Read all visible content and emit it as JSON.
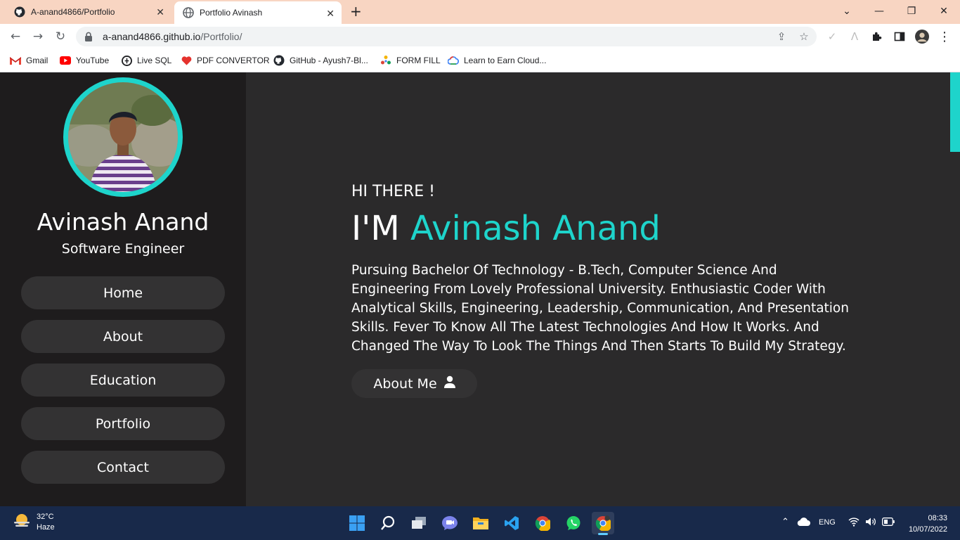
{
  "browser": {
    "tabs": [
      {
        "title": "A-anand4866/Portfolio",
        "icon": "github-icon",
        "active": false
      },
      {
        "title": "Portfolio Avinash",
        "icon": "globe-icon",
        "active": true
      }
    ],
    "url_host": "a-anand4866.github.io",
    "url_path": "/Portfolio/",
    "bookmarks": [
      {
        "label": "Gmail",
        "icon": "gmail-icon"
      },
      {
        "label": "YouTube",
        "icon": "youtube-icon"
      },
      {
        "label": "Live SQL",
        "icon": "livesql-icon"
      },
      {
        "label": "PDF CONVERTOR",
        "icon": "pdf-heart-icon"
      },
      {
        "label": "GitHub - Ayush7-Bl...",
        "icon": "github-icon"
      },
      {
        "label": "FORM FILL",
        "icon": "formfill-icon"
      },
      {
        "label": "Learn to Earn Cloud...",
        "icon": "google-cloud-icon"
      }
    ]
  },
  "sidebar": {
    "name": "Avinash Anand",
    "role": "Software Engineer",
    "nav": [
      {
        "label": "Home"
      },
      {
        "label": "About"
      },
      {
        "label": "Education"
      },
      {
        "label": "Portfolio"
      },
      {
        "label": "Contact"
      }
    ]
  },
  "hero": {
    "greeting": "HI THERE !",
    "im": "I'M",
    "highlight_name": "Avinash Anand",
    "bio": "Pursuing Bachelor Of Technology - B.Tech, Computer Science And Engineering From Lovely Professional University. Enthusiastic Coder With Analytical Skills, Engineering, Leadership, Communication, And Presentation Skills. Fever To Know All The Latest Technologies And How It Works. And Changed The Way To Look The Things And Then Starts To Build My Strategy.",
    "about_button": "About Me"
  },
  "taskbar": {
    "temperature": "32°C",
    "weather": "Haze",
    "language": "ENG",
    "time": "08:33",
    "date": "10/07/2022"
  },
  "colors": {
    "accent": "#1ed4cb",
    "sidebar_bg": "#1e1c1d",
    "main_bg": "#2b2a2b",
    "button_bg": "#333233",
    "tabstrip_bg": "#f8d5c2",
    "taskbar_bg": "#18294a"
  }
}
